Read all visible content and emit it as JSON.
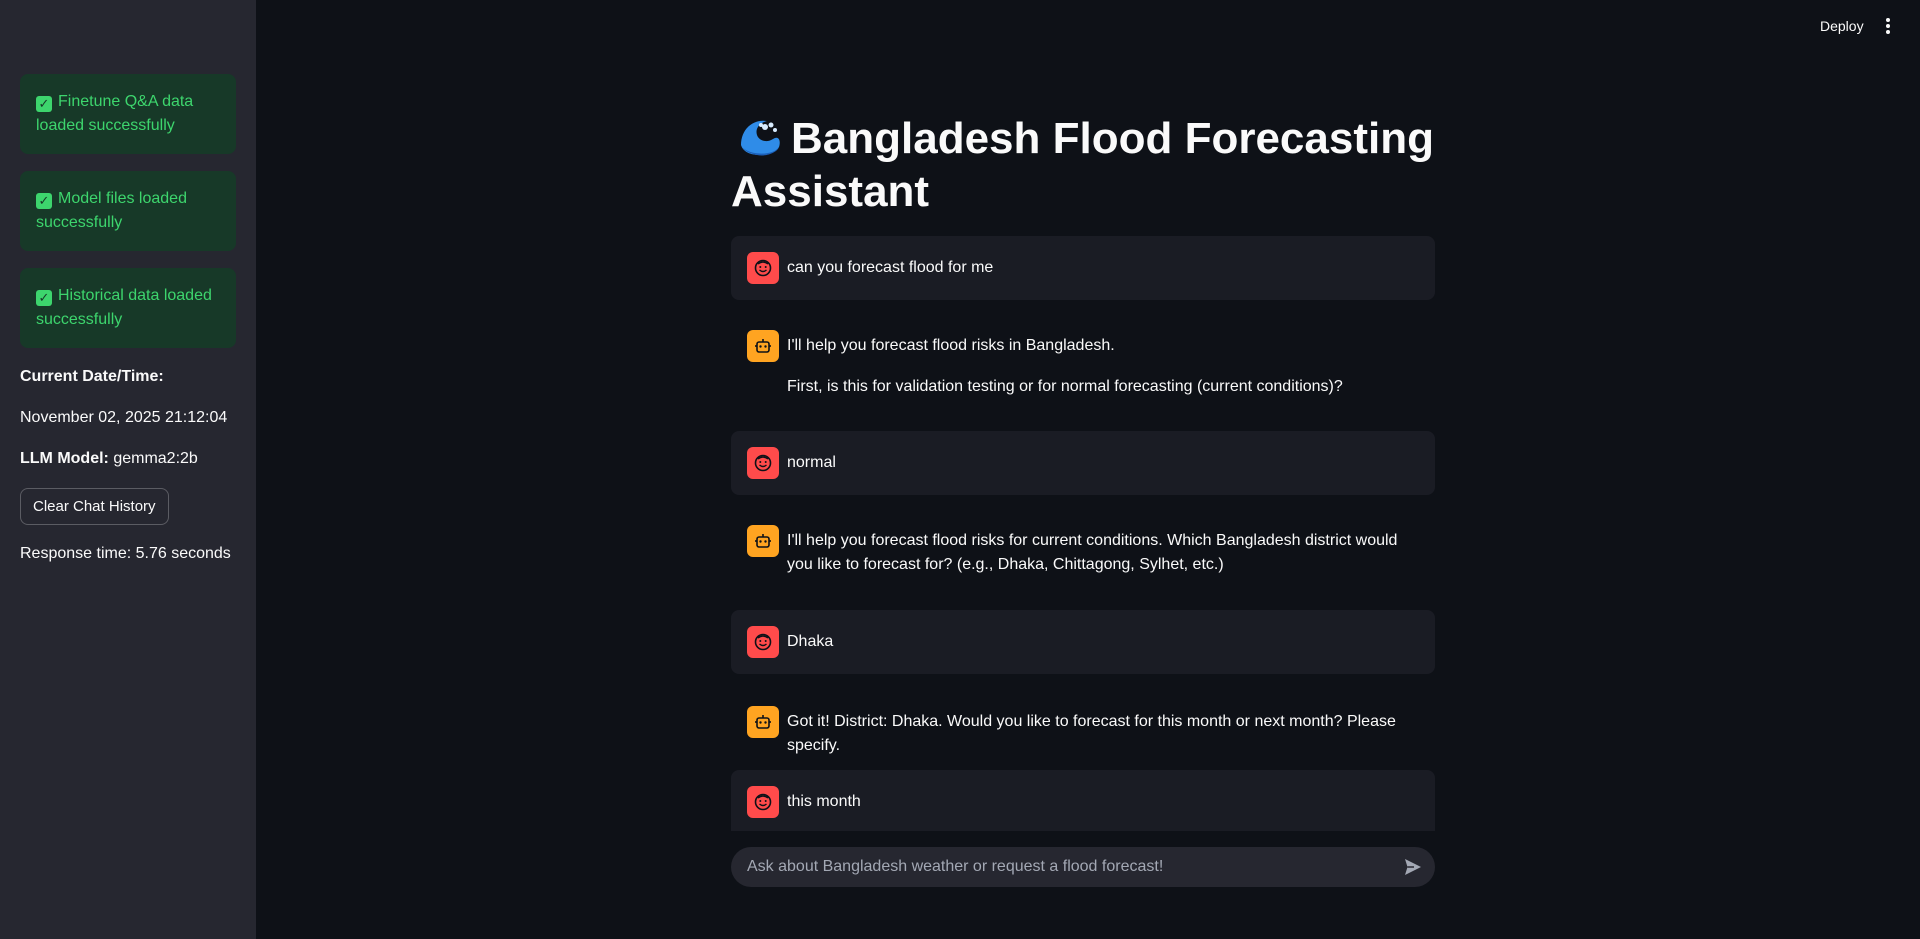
{
  "header": {
    "deploy_label": "Deploy",
    "menu_icon": "vertical-dots-icon"
  },
  "sidebar": {
    "alerts": [
      {
        "icon": "check-box-icon",
        "text": "Finetune Q&A data loaded successfully"
      },
      {
        "icon": "check-box-icon",
        "text": "Model files loaded successfully"
      },
      {
        "icon": "check-box-icon",
        "text": "Historical data loaded successfully"
      }
    ],
    "datetime_label": "Current Date/Time:",
    "datetime_value": "November 02, 2025 21:12:04",
    "llm_label": "LLM Model:",
    "llm_value": "gemma2:2b",
    "clear_button": "Clear Chat History",
    "response_time": "Response time: 5.76 seconds"
  },
  "main": {
    "title_icon": "water-wave-icon",
    "title": "Bangladesh Flood Forecasting Assistant",
    "messages": [
      {
        "role": "user",
        "avatar": "user-face-icon",
        "paragraphs": [
          "can you forecast flood for me"
        ]
      },
      {
        "role": "assistant",
        "avatar": "robot-icon",
        "paragraphs": [
          "I'll help you forecast flood risks in Bangladesh.",
          "First, is this for validation testing or for normal forecasting (current conditions)?"
        ]
      },
      {
        "role": "user",
        "avatar": "user-face-icon",
        "paragraphs": [
          "normal"
        ]
      },
      {
        "role": "assistant",
        "avatar": "robot-icon",
        "paragraphs": [
          "I'll help you forecast flood risks for current conditions. Which Bangladesh district would you like to forecast for? (e.g., Dhaka, Chittagong, Sylhet, etc.)"
        ]
      },
      {
        "role": "user",
        "avatar": "user-face-icon",
        "paragraphs": [
          "Dhaka"
        ]
      },
      {
        "role": "assistant",
        "avatar": "robot-icon",
        "paragraphs": [
          "Got it! District: Dhaka. Would you like to forecast for this month or next month? Please specify."
        ]
      },
      {
        "role": "user",
        "avatar": "user-face-icon",
        "paragraphs": [
          "this month"
        ]
      }
    ]
  },
  "chat_input": {
    "placeholder": "Ask about Bangladesh weather or request a flood forecast!",
    "value": "",
    "send_icon": "send-icon"
  },
  "colors": {
    "background": "#0e1117",
    "sidebar": "#262730",
    "success_bg": "#173928",
    "success_text": "#3dd56d",
    "user_avatar": "#ff4b4b",
    "bot_avatar": "#ffa421"
  }
}
